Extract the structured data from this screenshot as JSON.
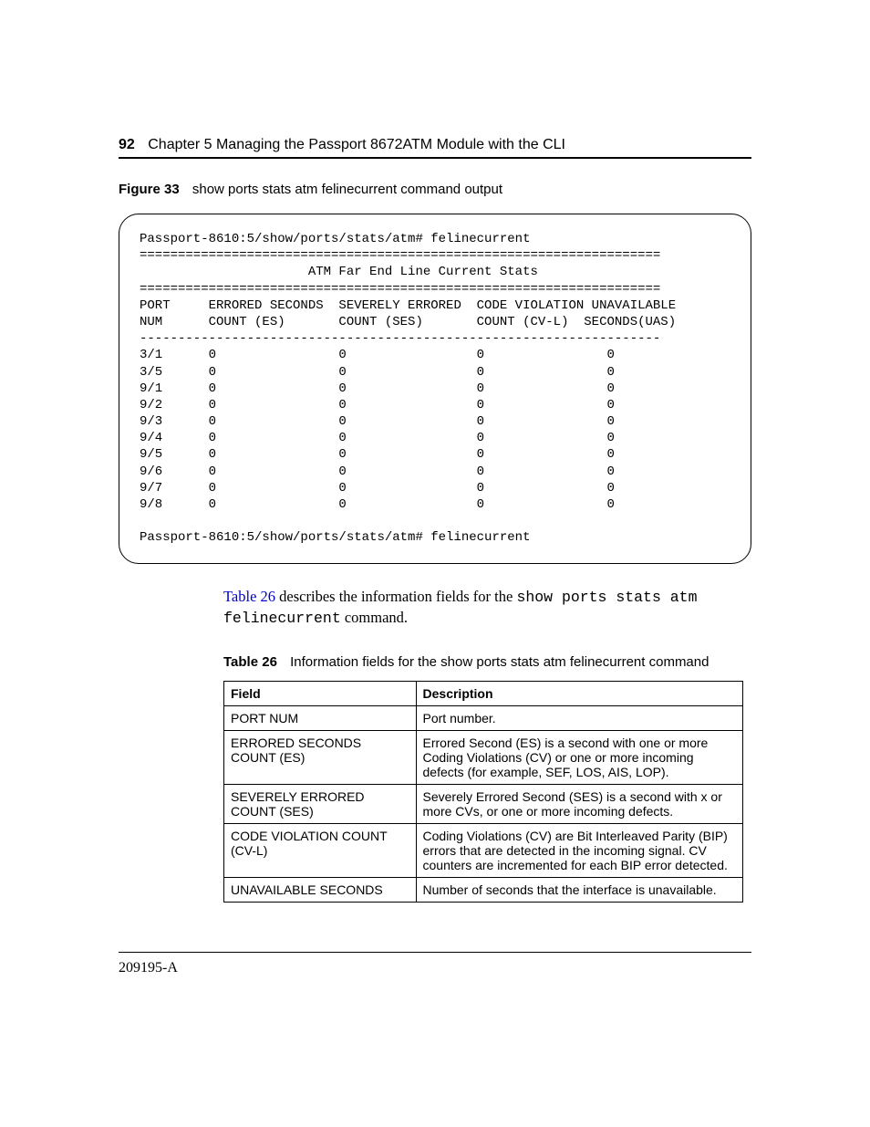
{
  "header": {
    "page_number": "92",
    "chapter_title": "Chapter 5  Managing the Passport 8672ATM Module with the CLI"
  },
  "figure": {
    "label": "Figure 33",
    "caption": "show ports stats atm felinecurrent command output",
    "terminal": {
      "prompt1": "Passport-8610:5/show/ports/stats/atm# felinecurrent",
      "hr_eq": "====================================================================",
      "title": "                      ATM Far End Line Current Stats",
      "col_head1": "PORT     ERRORED SECONDS  SEVERELY ERRORED  CODE VIOLATION UNAVAILABLE",
      "col_head2": "NUM      COUNT (ES)       COUNT (SES)       COUNT (CV-L)  SECONDS(UAS)",
      "hr_dash": "--------------------------------------------------------------------",
      "rows": [
        "3/1      0                0                 0                0",
        "3/5      0                0                 0                0",
        "9/1      0                0                 0                0",
        "9/2      0                0                 0                0",
        "9/3      0                0                 0                0",
        "9/4      0                0                 0                0",
        "9/5      0                0                 0                0",
        "9/6      0                0                 0                0",
        "9/7      0                0                 0                0",
        "9/8      0                0                 0                0"
      ],
      "prompt2": "Passport-8610:5/show/ports/stats/atm# felinecurrent"
    }
  },
  "paragraph": {
    "ref": "Table 26",
    "text_mid": " describes the information fields for the ",
    "code": "show ports stats atm felinecurrent",
    "text_end": " command."
  },
  "table": {
    "label": "Table 26",
    "caption": "Information fields for the show ports stats atm felinecurrent command",
    "head_field": "Field",
    "head_desc": "Description",
    "rows": [
      {
        "field": "PORT NUM",
        "desc": "Port number."
      },
      {
        "field": "ERRORED SECONDS COUNT (ES)",
        "desc": "Errored Second (ES) is a second with one or more Coding Violations (CV) or one or more incoming defects (for example, SEF, LOS, AIS, LOP)."
      },
      {
        "field": "SEVERELY ERRORED COUNT (SES)",
        "desc": "Severely Errored Second (SES) is a second with x or more CVs, or one or more incoming defects."
      },
      {
        "field": "CODE VIOLATION COUNT (CV-L)",
        "desc": "Coding Violations (CV) are Bit Interleaved Parity (BIP) errors that are detected in the incoming signal. CV counters are incremented for each BIP error detected."
      },
      {
        "field": "UNAVAILABLE SECONDS",
        "desc": "Number of seconds that the interface is unavailable."
      }
    ]
  },
  "footer": {
    "doc_id": "209195-A"
  }
}
